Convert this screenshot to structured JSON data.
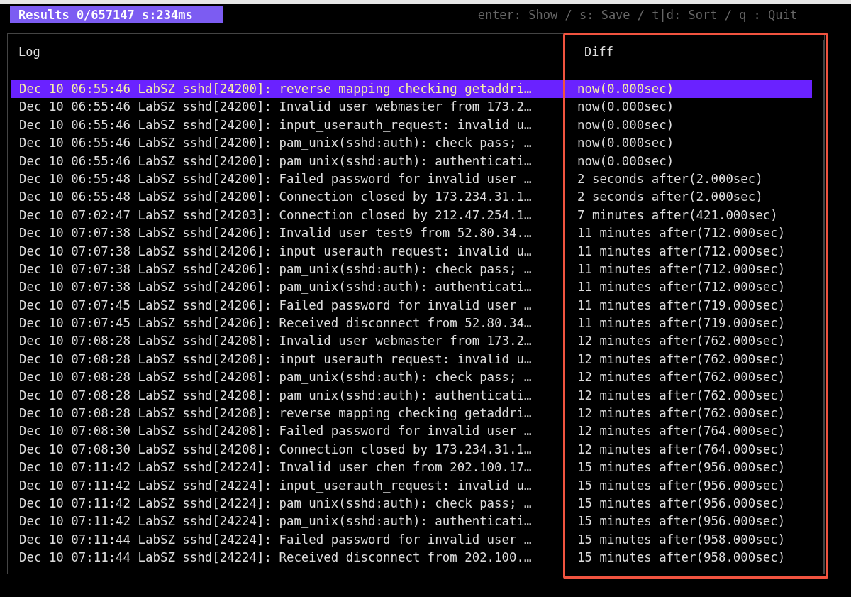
{
  "status": {
    "results": "Results 0/657147 s:234ms",
    "hints": "enter: Show / s: Save / t|d: Sort / q : Quit"
  },
  "table": {
    "columns": [
      "Log",
      "Diff"
    ],
    "rows": [
      {
        "log": "Dec 10 06:55:46 LabSZ sshd[24200]: reverse mapping checking getaddri…",
        "diff": "now(0.000sec)",
        "selected": true
      },
      {
        "log": "Dec 10 06:55:46 LabSZ sshd[24200]: Invalid user webmaster from 173.2…",
        "diff": "now(0.000sec)",
        "selected": false
      },
      {
        "log": "Dec 10 06:55:46 LabSZ sshd[24200]: input_userauth_request: invalid u…",
        "diff": "now(0.000sec)",
        "selected": false
      },
      {
        "log": "Dec 10 06:55:46 LabSZ sshd[24200]: pam_unix(sshd:auth): check pass; …",
        "diff": "now(0.000sec)",
        "selected": false
      },
      {
        "log": "Dec 10 06:55:46 LabSZ sshd[24200]: pam_unix(sshd:auth): authenticati…",
        "diff": "now(0.000sec)",
        "selected": false
      },
      {
        "log": "Dec 10 06:55:48 LabSZ sshd[24200]: Failed password for invalid user …",
        "diff": "2 seconds after(2.000sec)",
        "selected": false
      },
      {
        "log": "Dec 10 06:55:48 LabSZ sshd[24200]: Connection closed by 173.234.31.1…",
        "diff": "2 seconds after(2.000sec)",
        "selected": false
      },
      {
        "log": "Dec 10 07:02:47 LabSZ sshd[24203]: Connection closed by 212.47.254.1…",
        "diff": "7 minutes after(421.000sec)",
        "selected": false
      },
      {
        "log": "Dec 10 07:07:38 LabSZ sshd[24206]: Invalid user test9 from 52.80.34.…",
        "diff": "11 minutes after(712.000sec)",
        "selected": false
      },
      {
        "log": "Dec 10 07:07:38 LabSZ sshd[24206]: input_userauth_request: invalid u…",
        "diff": "11 minutes after(712.000sec)",
        "selected": false
      },
      {
        "log": "Dec 10 07:07:38 LabSZ sshd[24206]: pam_unix(sshd:auth): check pass; …",
        "diff": "11 minutes after(712.000sec)",
        "selected": false
      },
      {
        "log": "Dec 10 07:07:38 LabSZ sshd[24206]: pam_unix(sshd:auth): authenticati…",
        "diff": "11 minutes after(712.000sec)",
        "selected": false
      },
      {
        "log": "Dec 10 07:07:45 LabSZ sshd[24206]: Failed password for invalid user …",
        "diff": "11 minutes after(719.000sec)",
        "selected": false
      },
      {
        "log": "Dec 10 07:07:45 LabSZ sshd[24206]: Received disconnect from 52.80.34…",
        "diff": "11 minutes after(719.000sec)",
        "selected": false
      },
      {
        "log": "Dec 10 07:08:28 LabSZ sshd[24208]: Invalid user webmaster from 173.2…",
        "diff": "12 minutes after(762.000sec)",
        "selected": false
      },
      {
        "log": "Dec 10 07:08:28 LabSZ sshd[24208]: input_userauth_request: invalid u…",
        "diff": "12 minutes after(762.000sec)",
        "selected": false
      },
      {
        "log": "Dec 10 07:08:28 LabSZ sshd[24208]: pam_unix(sshd:auth): check pass; …",
        "diff": "12 minutes after(762.000sec)",
        "selected": false
      },
      {
        "log": "Dec 10 07:08:28 LabSZ sshd[24208]: pam_unix(sshd:auth): authenticati…",
        "diff": "12 minutes after(762.000sec)",
        "selected": false
      },
      {
        "log": "Dec 10 07:08:28 LabSZ sshd[24208]: reverse mapping checking getaddri…",
        "diff": "12 minutes after(762.000sec)",
        "selected": false
      },
      {
        "log": "Dec 10 07:08:30 LabSZ sshd[24208]: Failed password for invalid user …",
        "diff": "12 minutes after(764.000sec)",
        "selected": false
      },
      {
        "log": "Dec 10 07:08:30 LabSZ sshd[24208]: Connection closed by 173.234.31.1…",
        "diff": "12 minutes after(764.000sec)",
        "selected": false
      },
      {
        "log": "Dec 10 07:11:42 LabSZ sshd[24224]: Invalid user chen from 202.100.17…",
        "diff": "15 minutes after(956.000sec)",
        "selected": false
      },
      {
        "log": "Dec 10 07:11:42 LabSZ sshd[24224]: input_userauth_request: invalid u…",
        "diff": "15 minutes after(956.000sec)",
        "selected": false
      },
      {
        "log": "Dec 10 07:11:42 LabSZ sshd[24224]: pam_unix(sshd:auth): check pass; …",
        "diff": "15 minutes after(956.000sec)",
        "selected": false
      },
      {
        "log": "Dec 10 07:11:42 LabSZ sshd[24224]: pam_unix(sshd:auth): authenticati…",
        "diff": "15 minutes after(956.000sec)",
        "selected": false
      },
      {
        "log": "Dec 10 07:11:44 LabSZ sshd[24224]: Failed password for invalid user …",
        "diff": "15 minutes after(958.000sec)",
        "selected": false
      },
      {
        "log": "Dec 10 07:11:44 LabSZ sshd[24224]: Received disconnect from 202.100.…",
        "diff": "15 minutes after(958.000sec)",
        "selected": false
      }
    ]
  }
}
